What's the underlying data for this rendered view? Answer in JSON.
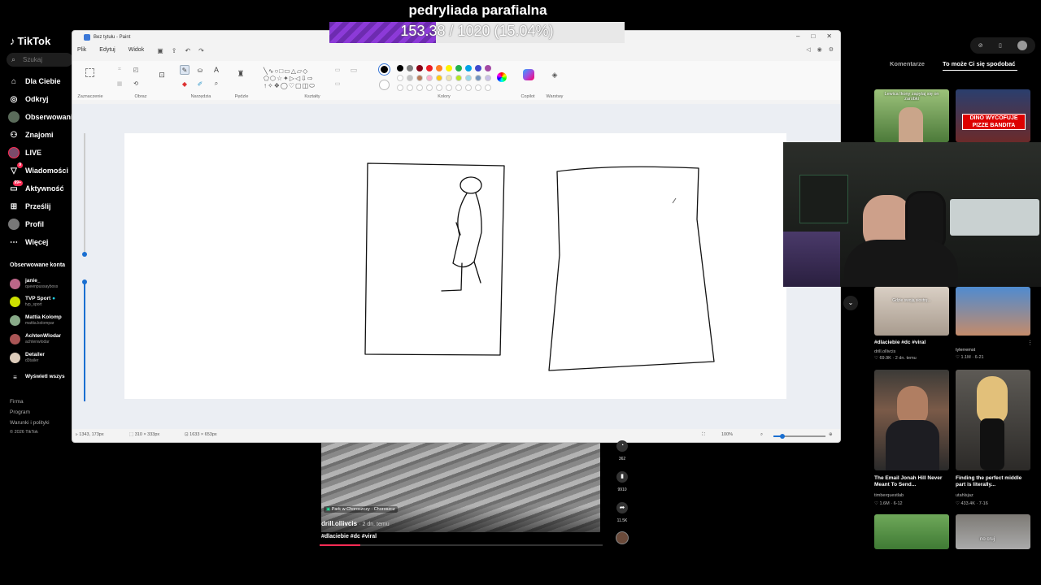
{
  "tiktok": {
    "logo": "TikTok",
    "search_placeholder": "Szukaj",
    "nav": [
      {
        "label": "Dla Ciebie",
        "icon": "home-icon"
      },
      {
        "label": "Odkryj",
        "icon": "compass-icon"
      },
      {
        "label": "Obserwowani",
        "icon": "following-icon"
      },
      {
        "label": "Znajomi",
        "icon": "friends-icon"
      },
      {
        "label": "LIVE",
        "icon": "live-icon"
      },
      {
        "label": "Wiadomości",
        "icon": "messages-icon",
        "badge": "9"
      },
      {
        "label": "Aktywność",
        "icon": "activity-icon",
        "badge": "99+"
      },
      {
        "label": "Prześlij",
        "icon": "upload-icon"
      },
      {
        "label": "Profil",
        "icon": "profile-icon"
      },
      {
        "label": "Więcej",
        "icon": "more-icon"
      }
    ],
    "following_header": "Obserwowane konta",
    "accounts": [
      {
        "name": "janie_",
        "handle": "queenpussayboss"
      },
      {
        "name": "TVP Sport",
        "handle": "tvp_sport"
      },
      {
        "name": "Mattia Kolomp",
        "handle": "mattia.kolompar"
      },
      {
        "name": "AchtenWlodar",
        "handle": "achtenwlodar"
      },
      {
        "name": "Detailer",
        "handle": "d3tailer"
      }
    ],
    "show_all": "Wyświetl wszys",
    "footer": [
      "Firma",
      "Program",
      "Warunki i polityki",
      "© 2026 TikTok"
    ]
  },
  "overlay": {
    "title": "pedryliada parafialna",
    "progress_text": "153.38 / 1020 (15.04%)",
    "progress": 0.1504
  },
  "paint": {
    "title": "Bez tytułu - Paint",
    "menu": [
      "Plik",
      "Edytuj",
      "Widok"
    ],
    "groups": [
      "Zaznaczenie",
      "Obraz",
      "Narzędzia",
      "Pędzle",
      "Kształty",
      "Kolory",
      "Copilot",
      "Warstwy"
    ],
    "status": {
      "cursor": "1343, 173px",
      "selection": "310 × 333px",
      "size": "1633 × 653px",
      "zoom": "100%"
    },
    "colors": [
      "#000000",
      "#7f7f7f",
      "#880015",
      "#ed1c24",
      "#ff7f27",
      "#fff200",
      "#22b14c",
      "#00a2e8",
      "#3f48cc",
      "#a349a4"
    ],
    "colors2": [
      "#ffffff",
      "#c3c3c3",
      "#b97a57",
      "#ffaec9",
      "#ffc90e",
      "#efe4b0",
      "#b5e61d",
      "#99d9ea",
      "#7092be",
      "#c8bfe7"
    ]
  },
  "video": {
    "location": "Park w Choroszczy · Choroszcz",
    "author": "drill.ollivcis",
    "time": "· 2 dn. temu",
    "tags": "#dlaciebie #dc #viral",
    "actions": [
      "362",
      "9910",
      "11.5K"
    ]
  },
  "right": {
    "tabs": [
      "Komentarze",
      "To może Ci się spodobać"
    ],
    "top_captions": [
      "Lewica Ikony zapytaj się on zarobki",
      "DINO WYCOFUJE PIZZE BANDITA"
    ],
    "items": [
      {
        "overlay": "Gdzie swoją siostrę...",
        "caption": "#dlaciebie #dc #viral",
        "author": "drill.ollivcis",
        "meta": "♡ 69.9K · 2 dn. temu"
      },
      {
        "overlay": "",
        "caption": "",
        "author": "tylerremst",
        "meta": "♡ 1.1M · 6-21"
      },
      {
        "overlay": "",
        "caption": "The Email Jonah Hill Never Meant To Send...",
        "author": "timberquestlab",
        "meta": "♡ 1.6M · 6-12"
      },
      {
        "overlay": "",
        "caption": "Finding the perfect middle part is literally...",
        "author": "utahlsjaz",
        "meta": "♡ 433.4K · 7-16"
      }
    ],
    "bottom_caption": "no cruj"
  }
}
